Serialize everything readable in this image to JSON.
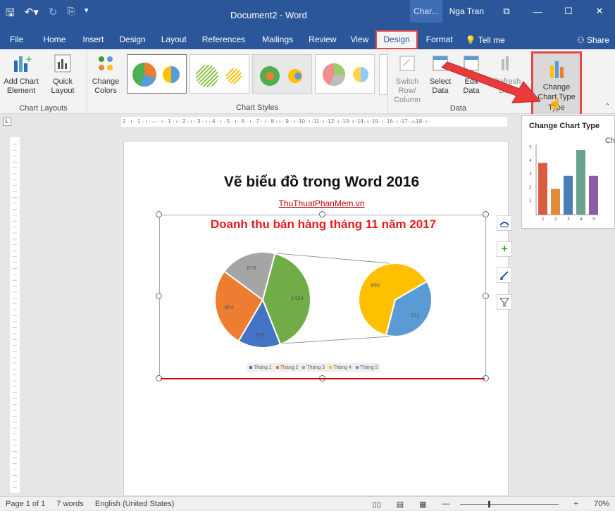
{
  "app": {
    "doc_title": "Document2 - Word",
    "context_tab": "Char...",
    "user": "Nga Tran"
  },
  "tabs": [
    "File",
    "Home",
    "Insert",
    "Design",
    "Layout",
    "References",
    "Mailings",
    "Review",
    "View",
    "Design",
    "Format"
  ],
  "tell_me": "Tell me",
  "share": "Share",
  "ribbon": {
    "chart_layouts": {
      "label": "Chart Layouts",
      "add_chart_element": "Add Chart Element",
      "quick_layout": "Quick Layout"
    },
    "change_colors": "Change Colors",
    "chart_styles": {
      "label": "Chart Styles"
    },
    "data": {
      "label": "Data",
      "switch_row_column": "Switch Row/ Column",
      "select_data": "Select Data",
      "edit_data": "Edit Data",
      "refresh_data": "Refresh Data"
    },
    "type": {
      "label": "Type",
      "change_chart_type": "Change Chart Type"
    }
  },
  "ruler_text": "2 · ı · 1 · ı · ⌵ · ı · 1 · ı · 2 · ı · 3 · ı · 4 · ı · 5 · ı · 6 · ı · 7 · ı · 8 · ı · 9 · ı ·10· ı ·11· ı ·12· ı ·13· ı ·14· ı ·15· ı ·16· ı ·17· △18· ı ·",
  "document": {
    "heading": "Vẽ biểu đồ trong Word 2016",
    "link": "ThuThuatPhanMem.vn"
  },
  "chart_data": {
    "type": "pie",
    "title": "Doanh thu bán hàng tháng 11 năm 2017",
    "categories": [
      "Tháng 1",
      "Tháng 2",
      "Tháng 3",
      "Tháng 4",
      "Tháng 5"
    ],
    "values": [
      516,
      954,
      678,
      892,
      532
    ],
    "secondary_value": 1424,
    "colors": [
      "#4472c4",
      "#ed7d31",
      "#a5a5a5",
      "#ffc000",
      "#5b9bd5",
      "#70ad47"
    ]
  },
  "tooltip": {
    "title": "Change Chart Type",
    "extra": "Ch",
    "preview_values": [
      4,
      2,
      3,
      5,
      3
    ],
    "preview_colors": [
      "#d95b43",
      "#e08a3c",
      "#4a7fb5",
      "#6aa28d",
      "#8e5ba8"
    ],
    "yticks": [
      "5",
      "4",
      "3",
      "2",
      "1"
    ],
    "xticks": [
      "1",
      "2",
      "3",
      "4",
      "5"
    ]
  },
  "status": {
    "page": "Page 1 of 1",
    "words": "7 words",
    "lang": "English (United States)",
    "zoom": "70%"
  }
}
